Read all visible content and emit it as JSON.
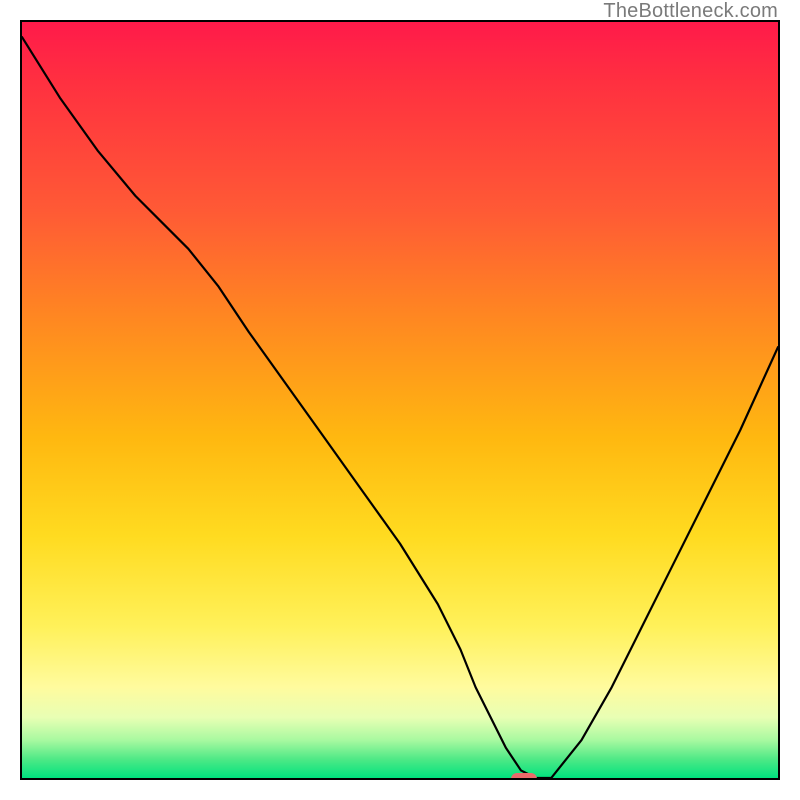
{
  "watermark": "TheBottleneck.com",
  "chart_data": {
    "type": "line",
    "title": "",
    "xlabel": "",
    "ylabel": "",
    "xlim": [
      0,
      100
    ],
    "ylim": [
      0,
      100
    ],
    "grid": false,
    "legend": false,
    "series": [
      {
        "name": "bottleneck-curve",
        "x": [
          0,
          5,
          10,
          15,
          18,
          22,
          26,
          30,
          35,
          40,
          45,
          50,
          55,
          58,
          60,
          62,
          64,
          66,
          68,
          70,
          74,
          78,
          82,
          86,
          90,
          95,
          100
        ],
        "y": [
          98,
          90,
          83,
          77,
          74,
          70,
          65,
          59,
          52,
          45,
          38,
          31,
          23,
          17,
          12,
          8,
          4,
          1,
          0,
          0,
          5,
          12,
          20,
          28,
          36,
          46,
          57
        ]
      }
    ],
    "marker": {
      "x": 66,
      "y": 0,
      "color": "#e96a6a"
    },
    "background_gradient": {
      "type": "vertical",
      "stops": [
        {
          "pos": 0,
          "color": "#ff1a4a"
        },
        {
          "pos": 0.25,
          "color": "#ff5a35"
        },
        {
          "pos": 0.55,
          "color": "#ffb810"
        },
        {
          "pos": 0.8,
          "color": "#fff15a"
        },
        {
          "pos": 0.95,
          "color": "#a8f9a0"
        },
        {
          "pos": 1.0,
          "color": "#00e27e"
        }
      ]
    }
  }
}
